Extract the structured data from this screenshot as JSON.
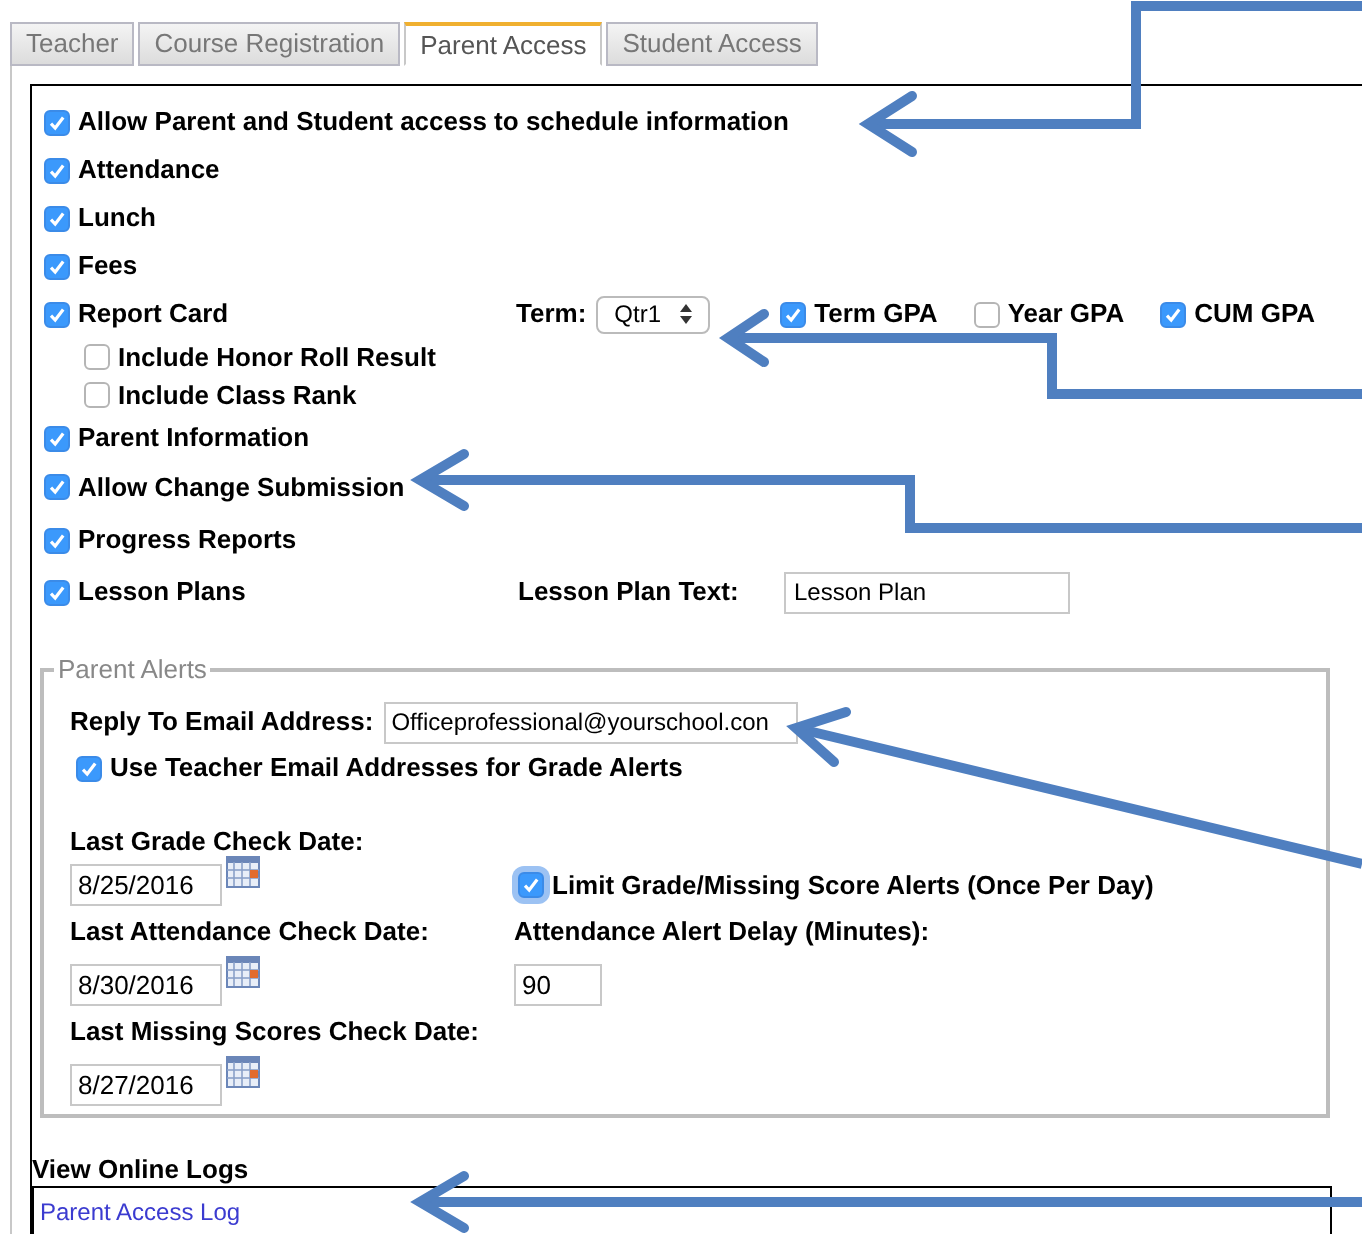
{
  "tabs": [
    {
      "label": "Teacher",
      "selected": false
    },
    {
      "label": "Course Registration",
      "selected": false
    },
    {
      "label": "Parent Access",
      "selected": true
    },
    {
      "label": "Student Access",
      "selected": false
    }
  ],
  "schedule_access": {
    "label": "Allow Parent and Student access to schedule information",
    "checked": true
  },
  "options": [
    {
      "label": "Attendance",
      "checked": true
    },
    {
      "label": "Lunch",
      "checked": true
    },
    {
      "label": "Fees",
      "checked": true
    },
    {
      "label": "Report Card",
      "checked": true,
      "children": [
        {
          "label": "Include Honor Roll Result",
          "checked": false
        },
        {
          "label": "Include Class Rank",
          "checked": false
        }
      ]
    },
    {
      "label": "Parent Information",
      "checked": true
    },
    {
      "label": "Allow Change Submission",
      "checked": true
    },
    {
      "label": "Progress Reports",
      "checked": true
    },
    {
      "label": "Lesson Plans",
      "checked": true
    }
  ],
  "term": {
    "label": "Term:",
    "value": "Qtr1"
  },
  "gpa_options": [
    {
      "label": "Term GPA",
      "checked": true
    },
    {
      "label": "Year GPA",
      "checked": false
    },
    {
      "label": "CUM GPA",
      "checked": true
    }
  ],
  "lesson_plan_text": {
    "label": "Lesson Plan Text:",
    "value": "Lesson Plan"
  },
  "parent_alerts": {
    "legend": "Parent Alerts",
    "reply_to": {
      "label": "Reply To Email Address:",
      "value": "Officeprofessional@yourschool.con"
    },
    "use_teacher_email": {
      "label": "Use Teacher Email Addresses for Grade Alerts",
      "checked": true
    },
    "last_grade_check": {
      "label": "Last Grade Check Date:",
      "value": "8/25/2016"
    },
    "limit_alerts": {
      "label": "Limit Grade/Missing Score Alerts (Once Per Day)",
      "checked": true
    },
    "last_attendance_check": {
      "label": "Last Attendance Check Date:",
      "value": "8/30/2016"
    },
    "attendance_delay": {
      "label": "Attendance Alert Delay (Minutes):",
      "value": "90"
    },
    "last_missing_scores_check": {
      "label": "Last Missing Scores Check Date:",
      "value": "8/27/2016"
    }
  },
  "online_logs": {
    "title": "View Online Logs",
    "links": [
      "Parent Access Log"
    ]
  }
}
